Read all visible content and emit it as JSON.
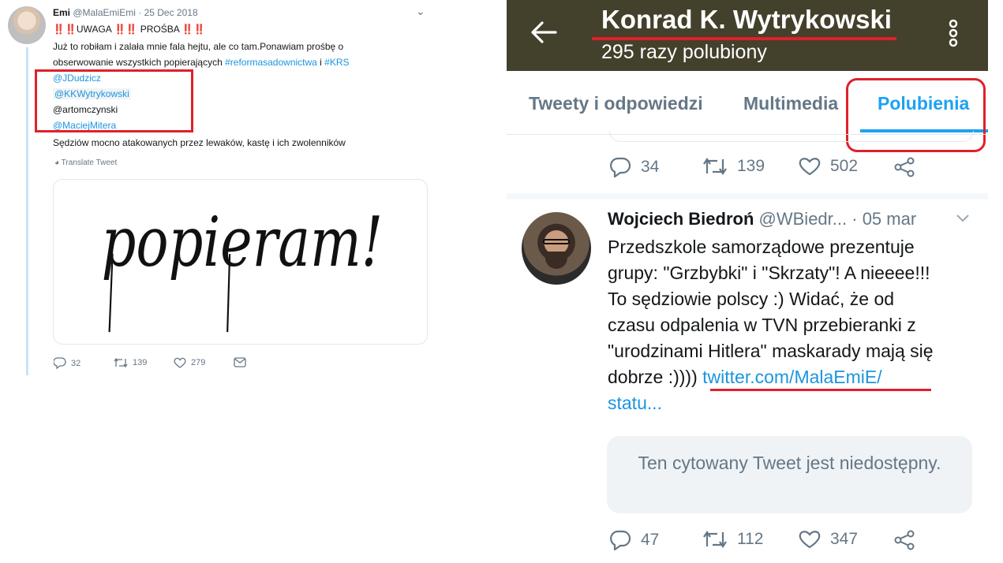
{
  "left_tweet": {
    "author_name": "Emi",
    "handle": "@MalaEmiEmi",
    "date": "· 25 Dec 2018",
    "line1_marks": "‼️‼️",
    "line1_a": "UWAGA",
    "line1_marks2": "‼️‼️",
    "line1_b": "PROŚBA",
    "line1_marks3": "‼️‼️",
    "text_line2": "Już to robiłam i zalała mnie fala hejtu, ale co tam.Ponawiam prośbę o",
    "text_line3_a": "obserwowanie wszystkich popierających ",
    "hashtag1": "#reformasadownictwa",
    "text_line3_b": " i ",
    "hashtag2": "#KRS",
    "mentions": [
      "@JDudzicz",
      "@KKWytrykowski",
      "@artomczynski",
      "@MaciejMitera"
    ],
    "text_line4": "Sędziów mocno atakowanych przez lewaków, kastę i ich zwolenników",
    "translate_label": "Translate Tweet",
    "image_word": "popieram!",
    "reply_count": "32",
    "retweet_count": "139",
    "like_count": "279"
  },
  "right_profile": {
    "name": "Konrad K. Wytrykowski",
    "likes_summary": "295 razy polubiony",
    "tabs": [
      {
        "label": "Tweety i odpowiedzi"
      },
      {
        "label": "Multimedia"
      },
      {
        "label": "Polubienia"
      }
    ],
    "prev_tweet_actions": {
      "replies": "34",
      "retweets": "139",
      "likes": "502"
    },
    "tweet": {
      "author_name": "Wojciech Biedroń",
      "handle": "@WBiedr...",
      "date": "· 05 mar",
      "text_lines": [
        "Przedszkole samorządowe prezentuje",
        "grupy: \"Grzbybki\" i \"Skrzaty\"! A nieeee!!!",
        "To sędziowie polscy :) Widać, że od",
        "czasu odpalenia w TVN przebieranki z",
        "\"urodzinami Hitlera\" maskarady mają się"
      ],
      "text_last_prefix": "dobrze :)))) ",
      "link_part1": "twitter.com/MalaEmiE/",
      "link_part2": "statu...",
      "quote_text": "Ten cytowany Tweet jest niedostępny.",
      "replies": "47",
      "retweets": "112",
      "likes": "347"
    }
  },
  "colors": {
    "header_bg": "#43412b",
    "accent": "#1da1f2",
    "highlight_red": "#e0202a",
    "muted": "#657786"
  }
}
